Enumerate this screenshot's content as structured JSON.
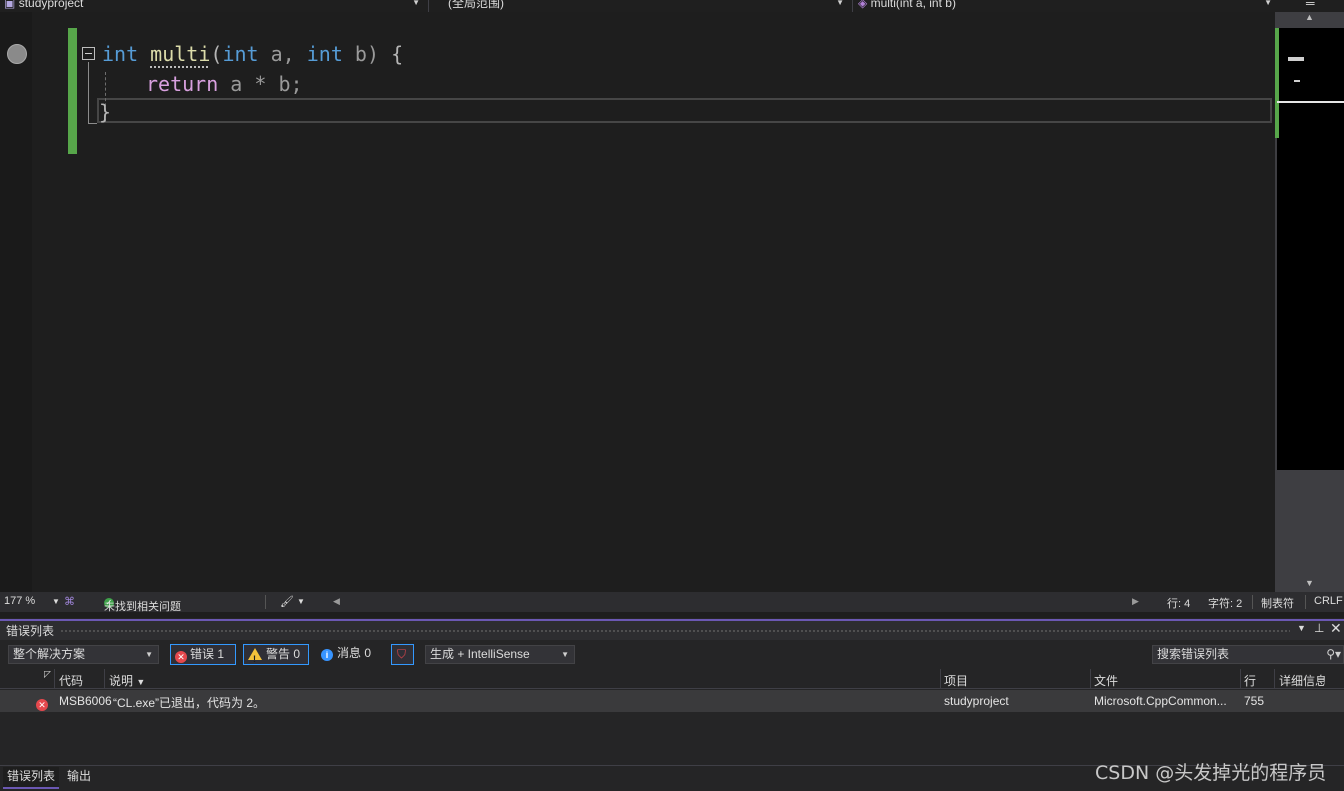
{
  "navbar": {
    "project": "studyproject",
    "scope": "(全局范围)",
    "member": "multi(int a, int b)"
  },
  "editor": {
    "code": {
      "l1_kw1": "int",
      "l1_fn": "multi",
      "l1_paren": "(",
      "l1_kw2": "int",
      "l1_p1": "a,",
      "l1_kw3": "int",
      "l1_p2": "b)",
      "l1_brace": "{",
      "l2_kw": "return",
      "l2_expr": "a * b;",
      "l3_brace": "}"
    }
  },
  "editor_status": {
    "zoom": "177 %",
    "issues": "未找到相关问题",
    "line": "行: 4",
    "char": "字符: 2",
    "tabs": "制表符",
    "eol": "CRLF"
  },
  "error_list": {
    "title": "错误列表",
    "scope": "整个解决方案",
    "errors_label": "错误 1",
    "warnings_label": "警告 0",
    "messages_label": "消息 0",
    "build_filter": "生成 + IntelliSense",
    "search_placeholder": "搜索错误列表",
    "columns": {
      "code": "代码",
      "desc": "说明",
      "project": "项目",
      "file": "文件",
      "line": "行",
      "details": "详细信息"
    },
    "rows": [
      {
        "code": "MSB6006",
        "desc": "“CL.exe”已退出，代码为 2。",
        "project": "studyproject",
        "file": "Microsoft.CppCommon...",
        "line": "755"
      }
    ]
  },
  "bottom_tabs": [
    "错误列表",
    "输出"
  ],
  "watermark": "CSDN @头发掉光的程序员",
  "colors": {
    "accent": "#6b58b3",
    "change_bar": "#57a64a",
    "error": "#e5484d"
  }
}
